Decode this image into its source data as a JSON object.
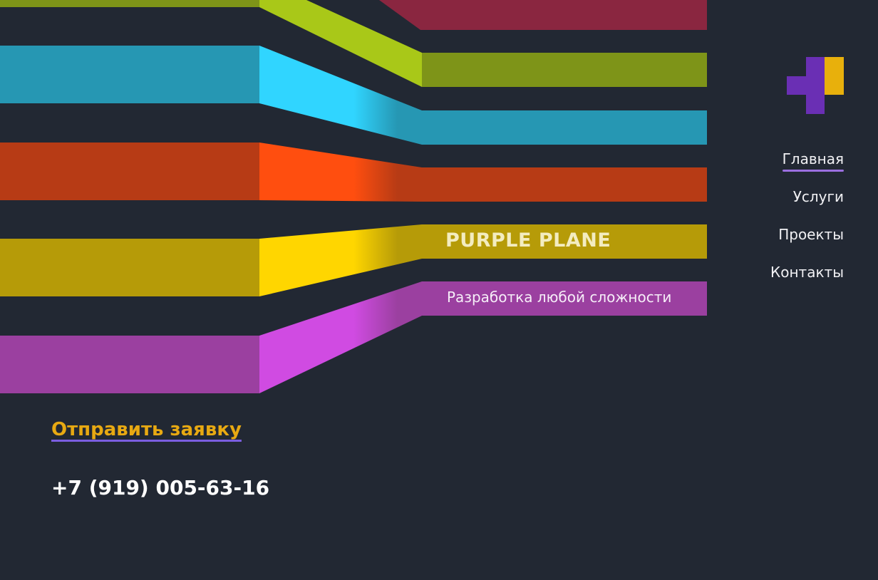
{
  "brand": {
    "title": "PURPLE PLANE",
    "subtitle": "Разработка любой сложности"
  },
  "logo": {
    "name": "brand-logo-icon",
    "colors": {
      "square": "#e8b00c",
      "cross": "#6a2fb4"
    }
  },
  "nav": {
    "items": [
      {
        "label": "Главная",
        "active": true
      },
      {
        "label": "Услуги",
        "active": false
      },
      {
        "label": "Проекты",
        "active": false
      },
      {
        "label": "Контакты",
        "active": false
      }
    ]
  },
  "cta": {
    "label": "Отправить заявку"
  },
  "contact": {
    "phone": "+7 (919) 005-63-16"
  },
  "colors": {
    "background": "#222833",
    "accent": "#e8a912",
    "underline": "#9b6fe0",
    "stripes": {
      "olive": "#7e9418",
      "lime": "#a9c818",
      "crimson": "#8a2640",
      "cyan": "#2697b3",
      "cyan_bright": "#30d5ff",
      "orange": "#b73b15",
      "orange_bright": "#ff4e0f",
      "yellow": "#b69b08",
      "yellow_bright": "#ffd600",
      "purple": "#9b40a0",
      "purple_bright": "#d04be2"
    }
  }
}
